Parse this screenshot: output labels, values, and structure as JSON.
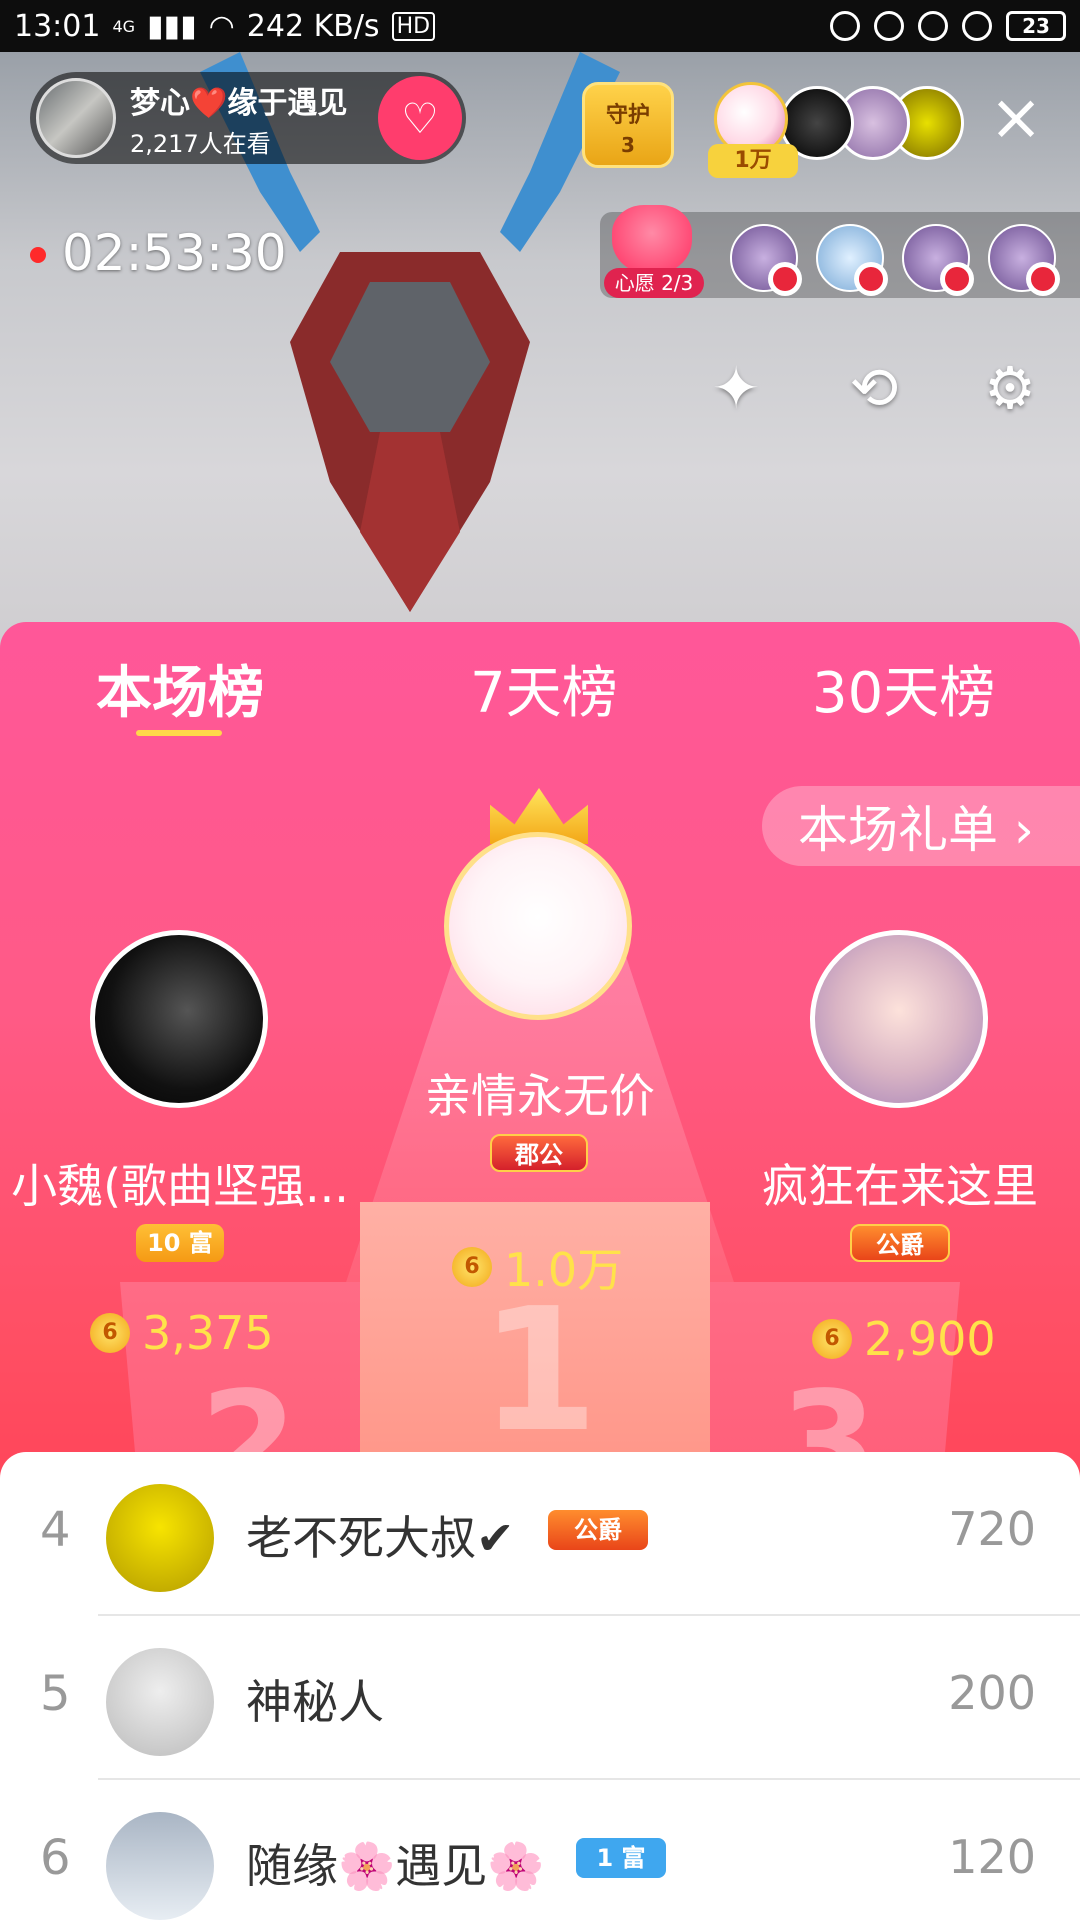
{
  "status_bar": {
    "time": "13:01",
    "network": "4G",
    "speed": "242 KB/s",
    "hd": "HD",
    "battery": "23"
  },
  "host": {
    "name": "梦心❤️缘于遇见",
    "viewers": "2,217人在看",
    "follow_icon": "heart-plus-icon"
  },
  "guard": {
    "label": "守护",
    "count": "3"
  },
  "top_viewers": {
    "badge": "1万"
  },
  "live_timer": "02:53:30",
  "wish": {
    "label": "心愿 2/3"
  },
  "tools": {
    "beauty_icon": "magic-wand-icon",
    "camera_icon": "camera-switch-icon",
    "settings_icon": "gear-icon"
  },
  "tabs": [
    "本场榜",
    "7天榜",
    "30天榜"
  ],
  "gift_list_button": "本场礼单 ›",
  "podium": {
    "first": {
      "name": "亲情永无价",
      "badge": "郡公",
      "amount": "1.0万",
      "rank": "1"
    },
    "second": {
      "name": "小魏(歌曲坚强...",
      "badge": "10 富",
      "amount": "3,375",
      "rank": "2"
    },
    "third": {
      "name": "疯狂在来这里",
      "badge": "公爵",
      "amount": "2,900",
      "rank": "3"
    }
  },
  "coin_symbol": "6",
  "list": [
    {
      "rank": "4",
      "name": "老不死大叔✔",
      "badge": "公爵",
      "score": "720"
    },
    {
      "rank": "5",
      "name": "神秘人",
      "badge": "",
      "score": "200"
    },
    {
      "rank": "6",
      "name": "随缘🌸遇见🌸",
      "badge": "1 富",
      "score": "120"
    }
  ],
  "colors": {
    "panel_top": "#ff5799",
    "panel_bottom": "#ff3a4d",
    "accent_gold": "#ffe24a"
  }
}
